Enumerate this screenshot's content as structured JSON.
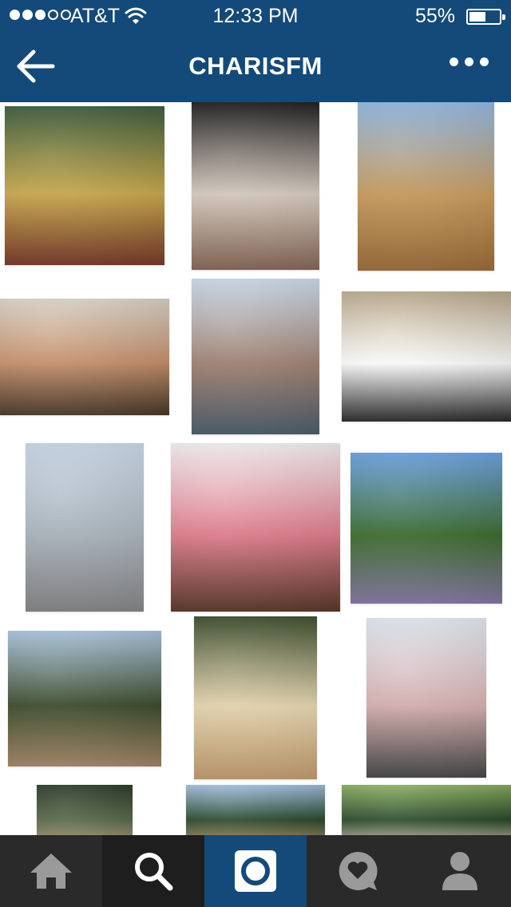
{
  "status_bar": {
    "carrier": "AT&T",
    "time": "12:33 PM",
    "battery_percent_label": "55%",
    "battery_level": 0.55,
    "signal_bars": 3,
    "signal_total": 5
  },
  "nav": {
    "title": "CHARISFM",
    "back_icon": "back-arrow-icon",
    "more_icon": "more-dots-icon"
  },
  "colors": {
    "brand": "#134a7a",
    "tab_bar": "#2a2a2a",
    "tab_selected_search": "#1e1e1e",
    "tab_camera": "#134a7a",
    "icon_gray": "#9a9a9a"
  },
  "photos": [
    {
      "subject": "mosaic-ceiling",
      "colors": [
        "#3a5a3a",
        "#c9a94a",
        "#7a3a2a"
      ]
    },
    {
      "subject": "cathedral",
      "colors": [
        "#1a1a1a",
        "#d8ccc0",
        "#8a6a5a"
      ]
    },
    {
      "subject": "hay-bale",
      "colors": [
        "#8fb5e0",
        "#c89a5a",
        "#a0703a"
      ]
    },
    {
      "subject": "group-selfie",
      "colors": [
        "#d9d3c8",
        "#c8906a",
        "#4a3a2a"
      ]
    },
    {
      "subject": "two-friends-city",
      "colors": [
        "#c9d9e9",
        "#a08070",
        "#506070"
      ]
    },
    {
      "subject": "palace-courtyard",
      "colors": [
        "#b9a88a",
        "#ffffff",
        "#2a2a2a"
      ]
    },
    {
      "subject": "louvre-pyramid",
      "colors": [
        "#c9d6e6",
        "#a9b4bc",
        "#8a8a8a"
      ]
    },
    {
      "subject": "macarons",
      "colors": [
        "#f2eef0",
        "#e07a8a",
        "#5a3a2a"
      ]
    },
    {
      "subject": "lavender-field",
      "colors": [
        "#6aa0e0",
        "#3a6a2a",
        "#8a7aa8"
      ]
    },
    {
      "subject": "cliff-view",
      "colors": [
        "#a9c4dc",
        "#3a4a2a",
        "#a88a6a"
      ]
    },
    {
      "subject": "cheese-market",
      "colors": [
        "#3a4a2a",
        "#e8d8b0",
        "#c8a070"
      ]
    },
    {
      "subject": "carousel",
      "colors": [
        "#dfe8f0",
        "#d8b0b0",
        "#4a4a4a"
      ]
    },
    {
      "subject": "statue-trees",
      "colors": [
        "#2a3a2a",
        "#5a6a4a",
        "#c0a880"
      ]
    },
    {
      "subject": "friends-outdoors",
      "colors": [
        "#a0c0e0",
        "#2a4a2a",
        "#c89a7a"
      ]
    },
    {
      "subject": "two-girls-park",
      "colors": [
        "#8ab060",
        "#2a4a2a",
        "#e0d0c0"
      ]
    }
  ],
  "tabs": [
    {
      "name": "home",
      "icon": "home-icon",
      "selected": false
    },
    {
      "name": "explore",
      "icon": "search-icon",
      "selected": true
    },
    {
      "name": "camera",
      "icon": "camera-icon",
      "selected": false
    },
    {
      "name": "activity",
      "icon": "heart-bubble-icon",
      "selected": false
    },
    {
      "name": "profile",
      "icon": "profile-icon",
      "selected": false
    }
  ]
}
